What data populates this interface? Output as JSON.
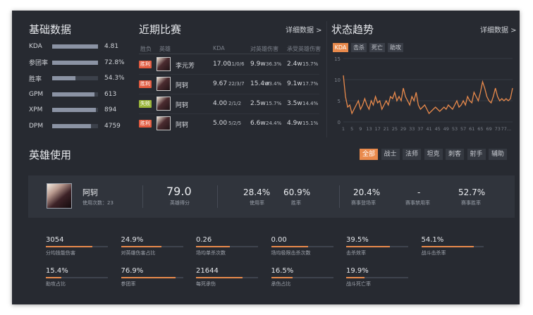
{
  "basic": {
    "title": "基础数据",
    "stats": [
      {
        "label": "KDA",
        "value": "4.81",
        "fill": 1.0
      },
      {
        "label": "参团率",
        "value": "72.8%",
        "fill": 1.0
      },
      {
        "label": "胜率",
        "value": "54.3%",
        "fill": 0.5
      },
      {
        "label": "GPM",
        "value": "613",
        "fill": 0.92
      },
      {
        "label": "XPM",
        "value": "894",
        "fill": 0.95
      },
      {
        "label": "DPM",
        "value": "4759",
        "fill": 0.85
      }
    ]
  },
  "recent": {
    "title": "近期比赛",
    "more": "详细数据 >",
    "headers": {
      "result": "胜负",
      "hero": "英雄",
      "kda": "KDA",
      "dmg": "对英雄伤害",
      "taken": "承受英雄伤害"
    },
    "rows": [
      {
        "result": "胜利",
        "result_color": "#e35a3f",
        "hero": "李元芳",
        "kda": "17.00",
        "kda_detail": "11/0/6",
        "dmg": "9.9w",
        "dmg_pct": "36.3%",
        "taken": "2.4w",
        "taken_pct": "15.7%"
      },
      {
        "result": "胜利",
        "result_color": "#e35a3f",
        "hero": "阿轲",
        "kda": "9.67",
        "kda_detail": "22/3/7",
        "dmg": "15.4w",
        "dmg_pct": "33.4%",
        "taken": "9.1w",
        "taken_pct": "17.7%"
      },
      {
        "result": "失败",
        "result_color": "#9bb63a",
        "hero": "阿轲",
        "kda": "4.00",
        "kda_detail": "2/1/2",
        "dmg": "2.5w",
        "dmg_pct": "15.7%",
        "taken": "3.5w",
        "taken_pct": "14.4%"
      },
      {
        "result": "胜利",
        "result_color": "#e35a3f",
        "hero": "阿轲",
        "kda": "5.00",
        "kda_detail": "5/2/5",
        "dmg": "6.6w",
        "dmg_pct": "24.4%",
        "taken": "4.9w",
        "taken_pct": "15.1%"
      }
    ]
  },
  "trend": {
    "title": "状态趋势",
    "more": "详细数据 >",
    "tabs": [
      "KDA",
      "击杀",
      "死亡",
      "助攻"
    ],
    "active_tab": "KDA",
    "accent": "#e98a4c"
  },
  "chart_data": {
    "type": "line",
    "title": "",
    "ylim": [
      0,
      15
    ],
    "yticks": [
      "15",
      "10",
      "5",
      "0"
    ],
    "xtick_labels": [
      "1",
      "5",
      "9",
      "13",
      "17",
      "21",
      "25",
      "29",
      "33",
      "37",
      "41",
      "45",
      "49",
      "53",
      "57",
      "61",
      "65",
      "69",
      "73",
      "77..."
    ],
    "x": [
      1,
      2,
      3,
      4,
      5,
      6,
      7,
      8,
      9,
      10,
      11,
      12,
      13,
      14,
      15,
      16,
      17,
      18,
      19,
      20,
      21,
      22,
      23,
      24,
      25,
      26,
      27,
      28,
      29,
      30,
      31,
      32,
      33,
      34,
      35,
      36,
      37,
      38,
      39,
      40,
      41,
      42,
      43,
      44,
      45,
      46,
      47,
      48,
      49,
      50,
      51,
      52,
      53,
      54,
      55,
      56,
      57,
      58,
      59,
      60,
      61,
      62,
      63,
      64,
      65,
      66,
      67,
      68,
      69,
      70,
      71,
      72,
      73,
      74,
      75,
      76,
      77,
      78,
      79,
      80
    ],
    "series": [
      {
        "values": [
          11,
          6,
          3.5,
          4,
          2,
          3,
          4,
          5,
          3,
          4,
          5.5,
          4,
          3,
          5,
          4,
          6,
          4.5,
          5,
          3,
          4,
          5,
          4,
          6,
          5.5,
          7,
          5,
          6,
          5,
          8,
          6,
          5,
          4,
          6,
          5,
          7,
          4,
          3,
          3.5,
          4,
          3,
          2,
          2.5,
          3,
          3.5,
          3,
          2.5,
          3,
          3.5,
          3,
          4,
          3.5,
          3,
          4,
          5,
          3.5,
          4,
          5,
          4,
          6,
          5,
          4.5,
          7,
          6,
          5,
          7,
          9.5,
          8,
          6,
          5,
          4.5,
          6,
          8,
          6,
          5,
          5.5,
          5,
          5.5,
          5,
          5.5,
          8
        ]
      }
    ]
  },
  "heroes": {
    "title": "英雄使用",
    "tabs": [
      "全部",
      "战士",
      "法师",
      "坦克",
      "刺客",
      "射手",
      "辅助"
    ],
    "active_tab": "全部",
    "card": {
      "name": "阿轲",
      "uses": "使用次数：23",
      "score": "79.0",
      "score_label": "英雄得分",
      "use_rate": "28.4%",
      "use_rate_label": "使用率",
      "win_rate": "60.9%",
      "win_rate_label": "胜率",
      "appear": "20.4%",
      "appear_label": "赛事登场率",
      "ban": "-",
      "ban_label": "赛事禁用率",
      "event_win": "52.7%",
      "event_win_label": "赛事胜率"
    },
    "metrics": [
      {
        "value": "3054",
        "label": "分均技能伤害",
        "fill": 0.75
      },
      {
        "value": "24.9%",
        "label": "对英雄伤害占比",
        "fill": 0.65
      },
      {
        "value": "0.26",
        "label": "场均单杀次数",
        "fill": 0.55
      },
      {
        "value": "0.00",
        "label": "场均极限击杀次数",
        "fill": 0.6
      },
      {
        "value": "39.5%",
        "label": "击杀效率",
        "fill": 0.7
      },
      {
        "value": "54.1%",
        "label": "战斗击杀率",
        "fill": 0.85
      },
      {
        "value": "15.4%",
        "label": "助攻占比",
        "fill": 0.25
      },
      {
        "value": "76.9%",
        "label": "参团率",
        "fill": 0.88
      },
      {
        "value": "21644",
        "label": "每死承伤",
        "fill": 0.75
      },
      {
        "value": "16.5%",
        "label": "承伤占比",
        "fill": 0.35
      },
      {
        "value": "19.9%",
        "label": "战斗死亡率",
        "fill": 0.3
      }
    ]
  }
}
